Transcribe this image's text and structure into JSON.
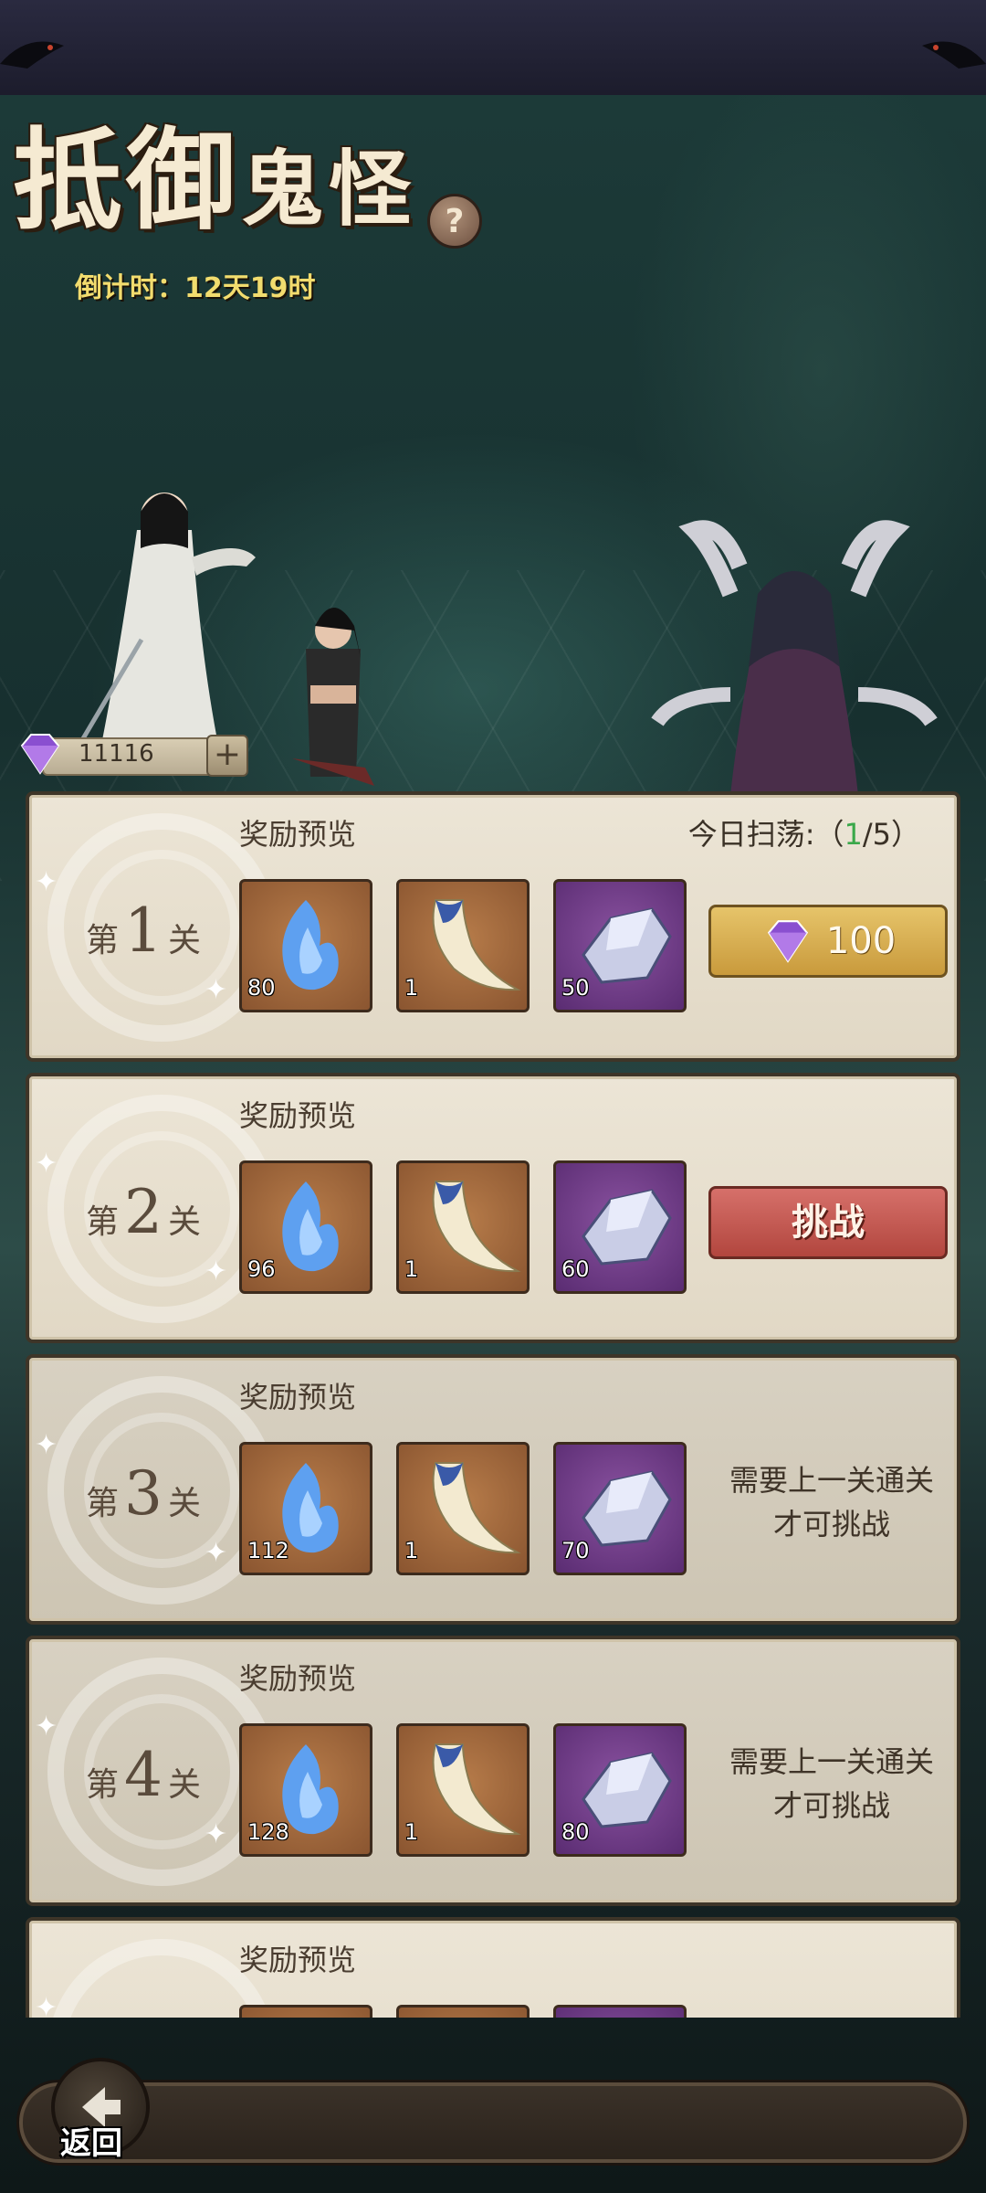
{
  "header": {
    "title_main": "抵御",
    "title_sub": "鬼怪",
    "help_label": "?",
    "countdown": "倒计时：12天19时"
  },
  "currency": {
    "gems": "11116",
    "plus_label": "+"
  },
  "stages": [
    {
      "pre": "第",
      "num": "1",
      "post": "关",
      "preview_label": "奖励预览",
      "sweep_label": "今日扫荡:（",
      "sweep_used": "1",
      "sweep_total": "/5）",
      "rewards": [
        "80",
        "1",
        "50"
      ],
      "action_type": "gem",
      "action_label": "100"
    },
    {
      "pre": "第",
      "num": "2",
      "post": "关",
      "preview_label": "奖励预览",
      "rewards": [
        "96",
        "1",
        "60"
      ],
      "action_type": "challenge",
      "action_label": "挑战"
    },
    {
      "pre": "第",
      "num": "3",
      "post": "关",
      "preview_label": "奖励预览",
      "rewards": [
        "112",
        "1",
        "70"
      ],
      "action_type": "locked",
      "lock_line1": "需要上一关通关",
      "lock_line2": "才可挑战"
    },
    {
      "pre": "第",
      "num": "4",
      "post": "关",
      "preview_label": "奖励预览",
      "rewards": [
        "128",
        "1",
        "80"
      ],
      "action_type": "locked",
      "lock_line1": "需要上一关通关",
      "lock_line2": "才可挑战"
    },
    {
      "preview_label": "奖励预览"
    }
  ],
  "reward_icons": [
    "blue-flame-icon",
    "horn-claw-icon",
    "ore-stone-icon"
  ],
  "footer": {
    "back_label": "返回"
  },
  "colors": {
    "gold_button": "#c99a3c",
    "red_button": "#b2463e",
    "sweep_green": "#3aa84a",
    "countdown_yellow": "#f2dc6e"
  }
}
